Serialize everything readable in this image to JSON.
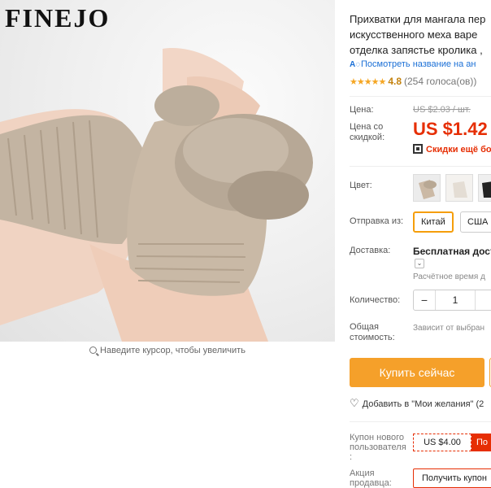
{
  "gallery": {
    "brand": "FINEJO",
    "zoom_hint": "Наведите курсор, чтобы увеличить"
  },
  "product": {
    "title_lines": [
      "Прихватки для мангала пер",
      "искусственного меха варе",
      "отделка запястье кролика ,"
    ],
    "translate_link": "Посмотреть название на ан",
    "translate_icon": "ai-translate-icon",
    "rating": "4.8",
    "votes": "(254 голоса(ов))",
    "stars_count": 5
  },
  "price": {
    "price_label": "Цена:",
    "old_price": "US $2.03 / шт.",
    "sale_label_line1": "Цена со",
    "sale_label_line2": "скидкой:",
    "sale_price": "US $1.42",
    "sale_unit": "/",
    "discount_text": "Скидки ещё бо"
  },
  "options": {
    "color_label": "Цвет:",
    "ship_from_label": "Отправка из:",
    "ship_from": [
      "Китай",
      "США"
    ],
    "ship_selected": "Китай",
    "delivery_label": "Доставка:",
    "delivery_value": "Бесплатная доста",
    "delivery_estimate": "Расчётное время д",
    "quantity_label": "Количество:",
    "quantity": "1",
    "total_label_line1": "Общая",
    "total_label_line2": "стоимость:",
    "total_value": "Зависит от выбран"
  },
  "actions": {
    "buy_now": "Купить сейчас",
    "wishlist": "Добавить в \"Мои желания\" (2"
  },
  "coupons": {
    "new_user_label_line1": "Купон нового",
    "new_user_label_line2": "пользователя",
    "new_user_label_line3": ":",
    "coupon_value": "US $4.00",
    "coupon_action": "По",
    "promo_label_line1": "Акция",
    "promo_label_line2": "продавца:",
    "promo_button": "Получить купон"
  },
  "colors": {
    "accent_orange": "#f5a02a",
    "price_red": "#e62e04",
    "link_blue": "#1a6fd6",
    "star": "#f5a623"
  }
}
